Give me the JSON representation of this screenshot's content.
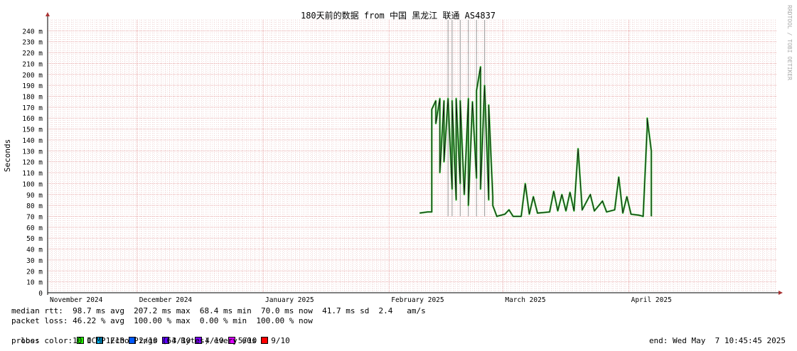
{
  "chart_data": {
    "type": "line",
    "title": "180天前的数据 from 中国 黑龙江 联通 AS4837",
    "ylabel": "Seconds",
    "watermark": "RRDTOOL / TOBI OETIKER",
    "ylim": [
      0,
      250
    ],
    "y_ticks": [
      {
        "value": 0,
        "label": "0"
      },
      {
        "value": 10,
        "label": "10 m"
      },
      {
        "value": 20,
        "label": "20 m"
      },
      {
        "value": 30,
        "label": "30 m"
      },
      {
        "value": 40,
        "label": "40 m"
      },
      {
        "value": 50,
        "label": "50 m"
      },
      {
        "value": 60,
        "label": "60 m"
      },
      {
        "value": 70,
        "label": "70 m"
      },
      {
        "value": 80,
        "label": "80 m"
      },
      {
        "value": 90,
        "label": "90 m"
      },
      {
        "value": 100,
        "label": "100 m"
      },
      {
        "value": 110,
        "label": "110 m"
      },
      {
        "value": 120,
        "label": "120 m"
      },
      {
        "value": 130,
        "label": "130 m"
      },
      {
        "value": 140,
        "label": "140 m"
      },
      {
        "value": 150,
        "label": "150 m"
      },
      {
        "value": 160,
        "label": "160 m"
      },
      {
        "value": 170,
        "label": "170 m"
      },
      {
        "value": 180,
        "label": "180 m"
      },
      {
        "value": 190,
        "label": "190 m"
      },
      {
        "value": 200,
        "label": "200 m"
      },
      {
        "value": 210,
        "label": "210 m"
      },
      {
        "value": 220,
        "label": "220 m"
      },
      {
        "value": 230,
        "label": "230 m"
      },
      {
        "value": 240,
        "label": "240 m"
      }
    ],
    "x_range": [
      "2024-11-09",
      "2025-05-07"
    ],
    "x_ticks": [
      {
        "date": "2024-11-01",
        "label": "November 2024"
      },
      {
        "date": "2024-12-01",
        "label": "December 2024"
      },
      {
        "date": "2025-01-01",
        "label": "January 2025"
      },
      {
        "date": "2025-02-01",
        "label": "February 2025"
      },
      {
        "date": "2025-03-01",
        "label": "March 2025"
      },
      {
        "date": "2025-04-01",
        "label": "April 2025"
      }
    ],
    "grid": true,
    "series": [
      {
        "name": "median rtt",
        "points": [
          [
            "2025-02-08",
            73
          ],
          [
            "2025-02-10",
            74
          ],
          [
            "2025-02-11",
            74
          ],
          [
            "2025-02-11",
            168
          ],
          [
            "2025-02-12",
            176
          ],
          [
            "2025-02-12",
            155
          ],
          [
            "2025-02-13",
            178
          ],
          [
            "2025-02-13",
            110
          ],
          [
            "2025-02-14",
            176
          ],
          [
            "2025-02-14",
            120
          ],
          [
            "2025-02-15",
            178
          ],
          [
            "2025-02-16",
            95
          ],
          [
            "2025-02-16",
            176
          ],
          [
            "2025-02-17",
            85
          ],
          [
            "2025-02-17",
            178
          ],
          [
            "2025-02-18",
            100
          ],
          [
            "2025-02-18",
            176
          ],
          [
            "2025-02-19",
            90
          ],
          [
            "2025-02-20",
            178
          ],
          [
            "2025-02-20",
            80
          ],
          [
            "2025-02-21",
            175
          ],
          [
            "2025-02-22",
            105
          ],
          [
            "2025-02-22",
            185
          ],
          [
            "2025-02-23",
            207
          ],
          [
            "2025-02-23",
            95
          ],
          [
            "2025-02-24",
            190
          ],
          [
            "2025-02-25",
            85
          ],
          [
            "2025-02-25",
            172
          ],
          [
            "2025-02-26",
            88
          ],
          [
            "2025-02-26",
            80
          ],
          [
            "2025-02-27",
            70
          ],
          [
            "2025-03-01",
            72
          ],
          [
            "2025-03-02",
            76
          ],
          [
            "2025-03-03",
            70
          ],
          [
            "2025-03-05",
            70
          ],
          [
            "2025-03-06",
            100
          ],
          [
            "2025-03-07",
            72
          ],
          [
            "2025-03-08",
            88
          ],
          [
            "2025-03-09",
            73
          ],
          [
            "2025-03-12",
            74
          ],
          [
            "2025-03-13",
            93
          ],
          [
            "2025-03-14",
            75
          ],
          [
            "2025-03-15",
            90
          ],
          [
            "2025-03-16",
            75
          ],
          [
            "2025-03-17",
            92
          ],
          [
            "2025-03-18",
            75
          ],
          [
            "2025-03-19",
            132
          ],
          [
            "2025-03-20",
            76
          ],
          [
            "2025-03-22",
            90
          ],
          [
            "2025-03-23",
            75
          ],
          [
            "2025-03-25",
            84
          ],
          [
            "2025-03-26",
            74
          ],
          [
            "2025-03-28",
            76
          ],
          [
            "2025-03-29",
            106
          ],
          [
            "2025-03-30",
            73
          ],
          [
            "2025-03-31",
            88
          ],
          [
            "2025-04-01",
            72
          ],
          [
            "2025-04-03",
            71
          ],
          [
            "2025-04-04",
            70
          ],
          [
            "2025-04-05",
            152
          ],
          [
            "2025-04-05",
            160
          ],
          [
            "2025-04-06",
            130
          ],
          [
            "2025-04-06",
            70
          ]
        ]
      }
    ],
    "loss_spikes": [
      "2025-02-15",
      "2025-02-16",
      "2025-02-18",
      "2025-02-20",
      "2025-02-22",
      "2025-02-24"
    ]
  },
  "stats": {
    "median_rtt": "median rtt:  98.7 ms avg  207.2 ms max  68.4 ms min  70.0 ms now  41.7 ms sd  2.4   am/s",
    "packet_loss": "packet loss: 46.22 % avg  100.00 % max  0.00 % min  100.00 % now",
    "loss_color_label": "loss color:",
    "probe": "probe:       10 ICMP Echo Pings (64 Bytes) every 60s",
    "end": "end: Wed May  7 10:45:45 2025"
  },
  "loss_colors": [
    {
      "label": "0",
      "color": "#26ff00"
    },
    {
      "label": "1/10",
      "color": "#00b8ff"
    },
    {
      "label": "2/10",
      "color": "#0059ff"
    },
    {
      "label": "3/10",
      "color": "#5e00ff"
    },
    {
      "label": "4/10",
      "color": "#7e00ff"
    },
    {
      "label": "5/10",
      "color": "#dd00ff"
    },
    {
      "label": "9/10",
      "color": "#ff0000"
    }
  ]
}
